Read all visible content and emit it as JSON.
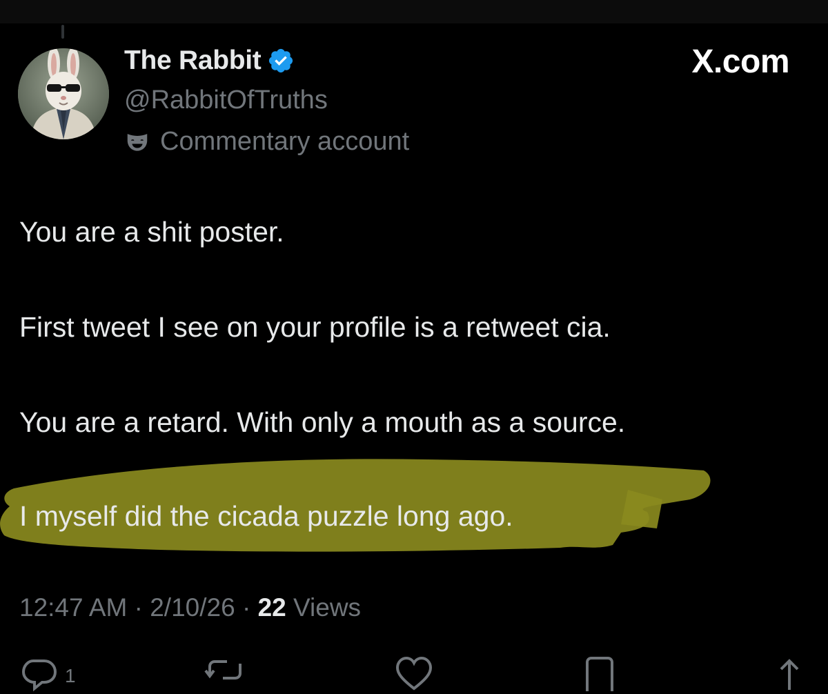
{
  "author": {
    "display_name": "The Rabbit",
    "handle": "@RabbitOfTruths",
    "account_label": "Commentary account",
    "verified": true
  },
  "watermark": "X.com",
  "tweet": {
    "lines": [
      "You are a shit poster.",
      "First tweet I see on your profile is a retweet cia.",
      "You are a retard. With only a mouth as a source.",
      "I myself did the cicada puzzle long ago."
    ],
    "highlighted_line_index": 3
  },
  "meta": {
    "time": "12:47 AM",
    "separator": "·",
    "date": "2/10/26",
    "views_count": "22",
    "views_label": "Views"
  },
  "actions": {
    "reply_count": "1"
  },
  "colors": {
    "background": "#000000",
    "text_primary": "#e7e9ea",
    "text_secondary": "#71767b",
    "verified_badge": "#1d9bf0",
    "highlight": "#8a8a1e"
  },
  "icons": [
    "verified-badge-icon",
    "parody-mask-icon",
    "reply-icon",
    "repost-icon",
    "like-icon",
    "bookmark-icon",
    "share-icon"
  ]
}
